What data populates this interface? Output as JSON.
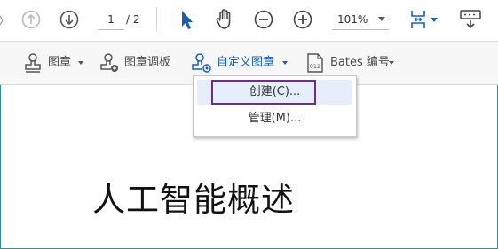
{
  "toolbar": {
    "page_current": "1",
    "page_total": "/ 2",
    "zoom_value": "101%",
    "icons": [
      "arrow-up-circle-icon",
      "arrow-down-circle-icon",
      "select-arrow-icon",
      "hand-icon",
      "zoom-out-icon",
      "zoom-in-icon",
      "fit-page-icon",
      "keyboard-icon"
    ]
  },
  "stamp_toolbar": {
    "stamp_label": "图章",
    "stamp_palette_label": "图章调板",
    "custom_stamp_label": "自定义图章",
    "bates_label": "Bates 编号"
  },
  "dropdown": {
    "items": [
      {
        "label": "创建(C)..."
      },
      {
        "label": "管理(M)..."
      }
    ]
  },
  "document": {
    "title": "人工智能概述"
  },
  "colors": {
    "accent": "#1a5fb4",
    "highlight_border": "#6f2c8a",
    "highlight_bg": "#e5eefa"
  }
}
